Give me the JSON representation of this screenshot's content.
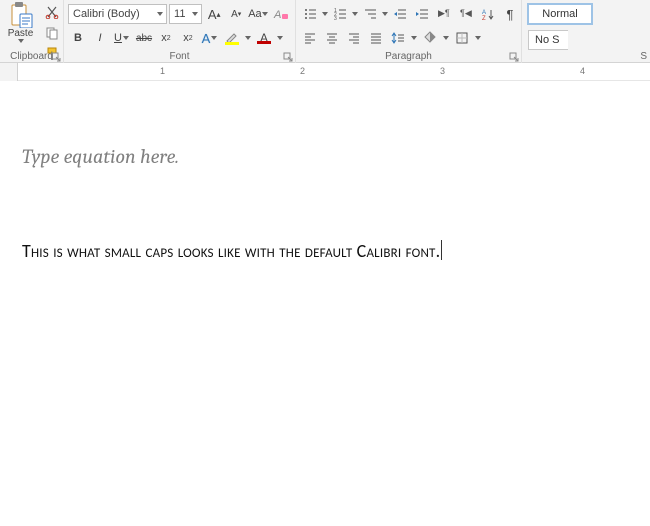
{
  "clipboard": {
    "label": "Clipboard",
    "paste": "Paste"
  },
  "font": {
    "label": "Font",
    "name": "Calibri (Body)",
    "size": "11",
    "grow": "A",
    "shrink": "A",
    "caseBtn": "Aa",
    "bold": "B",
    "italic": "I",
    "underline": "U",
    "strike": "abc",
    "sub": "x",
    "sup": "x",
    "textfx": "A",
    "highlight_color": "#ffff00",
    "font_color": "#c00000"
  },
  "paragraph": {
    "label": "Paragraph"
  },
  "styles": {
    "label": "S",
    "normal": "Normal",
    "nospacing": "No S"
  },
  "ruler": {
    "marks": [
      "1",
      "2",
      "3",
      "4"
    ]
  },
  "doc": {
    "equation_placeholder": "Type equation here.",
    "smallcaps_text": "This is what small caps looks like with the default Calibri font."
  }
}
